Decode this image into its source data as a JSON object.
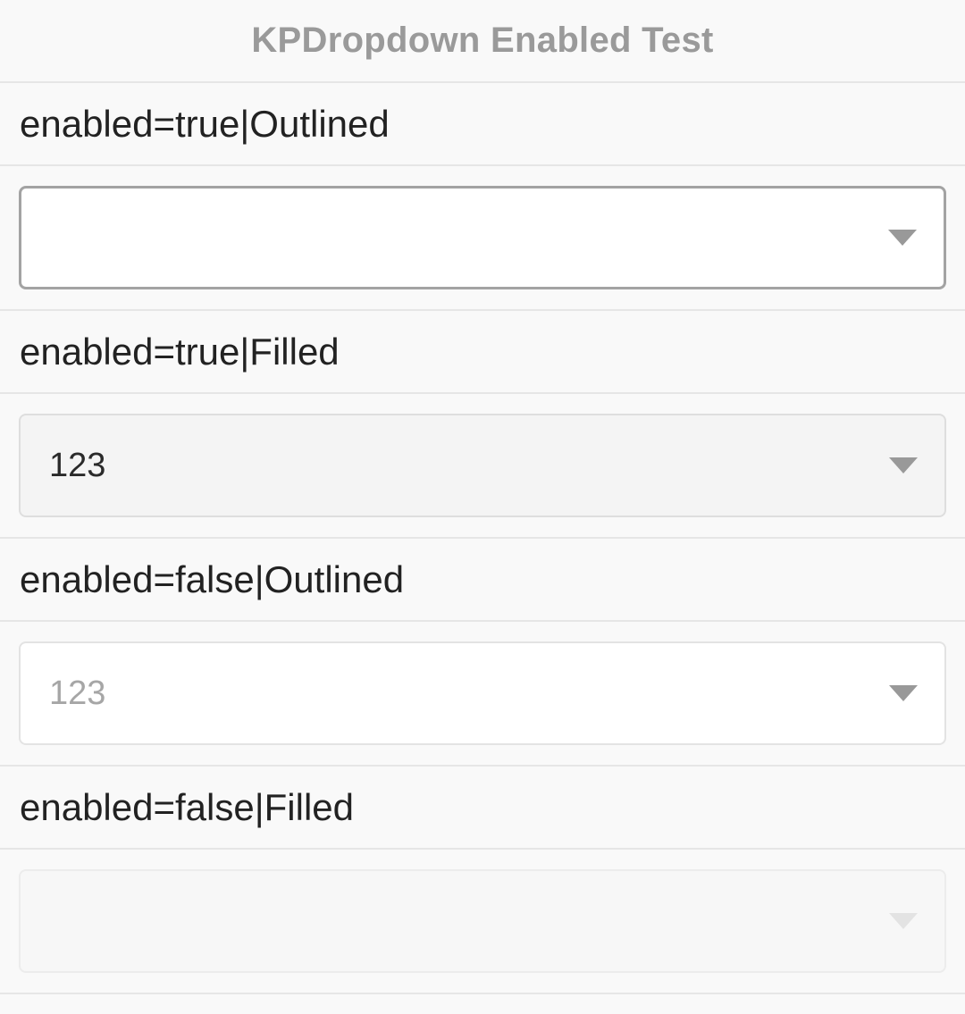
{
  "nav": {
    "title": "KPDropdown Enabled Test"
  },
  "sections": [
    {
      "label": "enabled=true|Outlined",
      "value": "",
      "enabled": true,
      "style": "Outlined"
    },
    {
      "label": "enabled=true|Filled",
      "value": "123",
      "enabled": true,
      "style": "Filled"
    },
    {
      "label": "enabled=false|Outlined",
      "value": "123",
      "enabled": false,
      "style": "Outlined"
    },
    {
      "label": "enabled=false|Filled",
      "value": "",
      "enabled": false,
      "style": "Filled"
    }
  ],
  "icons": {
    "dropdown_arrow": "chevron-down-icon"
  },
  "colors": {
    "background": "#f9f9f9",
    "divider": "#e6e6e6",
    "title": "#9a9a9a",
    "label_text": "#222222",
    "enabled_outline": "#a3a3a3",
    "filled_background": "#f4f4f4",
    "disabled_text": "#a6a6a6",
    "caret": "#999999"
  }
}
